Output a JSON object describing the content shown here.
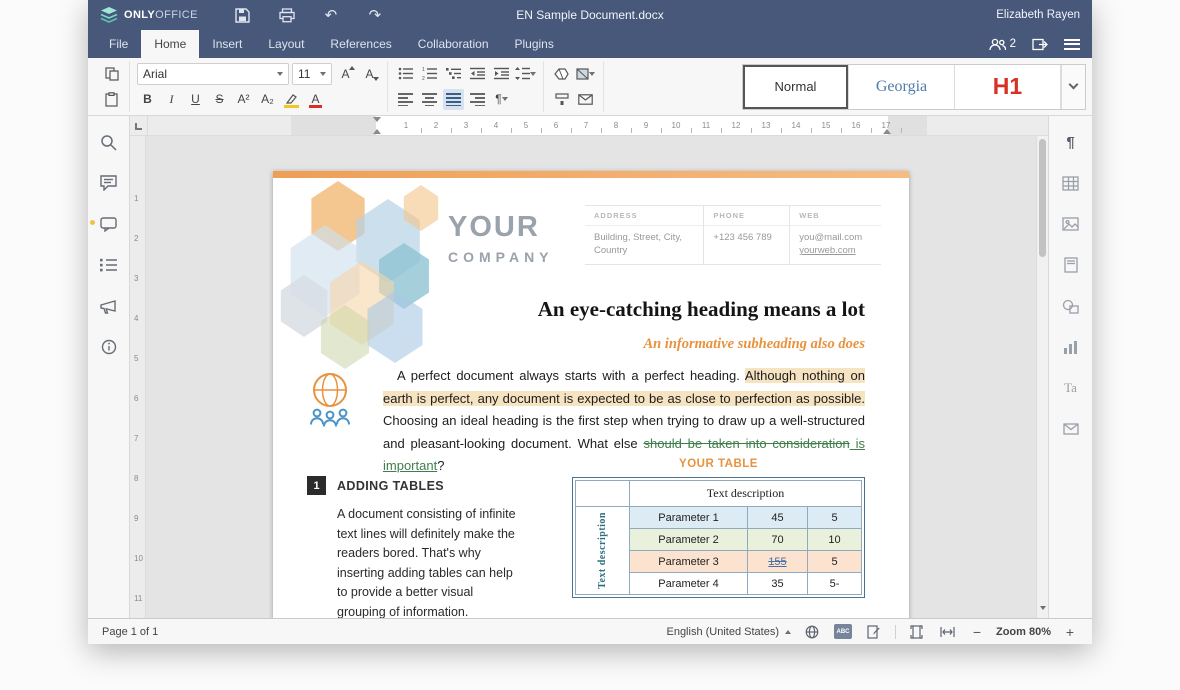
{
  "titlebar": {
    "brand_bold": "ONLY",
    "brand_light": "OFFICE",
    "document_title": "EN Sample Document.docx",
    "user_name": "Elizabeth Rayen"
  },
  "tabs": {
    "file": "File",
    "home": "Home",
    "insert": "Insert",
    "layout": "Layout",
    "references": "References",
    "collaboration": "Collaboration",
    "plugins": "Plugins",
    "users_count": "2"
  },
  "toolbar": {
    "font_name": "Arial",
    "font_size": "11",
    "letter_a": "A",
    "bold": "B",
    "italic": "I",
    "underline": "U",
    "strike": "S",
    "superscript": "A²",
    "subscript": "A₂",
    "para_mark": "¶",
    "styles": {
      "normal": "Normal",
      "georgia": "Georgia",
      "h1": "H1"
    }
  },
  "icons": {
    "undo": "↶",
    "redo": "↷",
    "text_art": "Ta"
  },
  "ruler": {
    "h": [
      "1",
      "2",
      "3",
      "4",
      "5",
      "6",
      "7",
      "8",
      "9",
      "10",
      "11",
      "12",
      "13",
      "14",
      "15",
      "16",
      "17"
    ],
    "v": [
      "1",
      "2",
      "3",
      "4",
      "5",
      "6",
      "7",
      "8",
      "9",
      "10",
      "11"
    ]
  },
  "doc": {
    "company_line1": "YOUR",
    "company_line2": "COMPANY",
    "contact": {
      "address_label": "ADDRESS",
      "phone_label": "PHONE",
      "web_label": "WEB",
      "address_1": "Building, Street, City,",
      "address_2": "Country",
      "phone": "+123 456 789",
      "web_1": "you@mail.com",
      "web_2": "yourweb.com"
    },
    "heading": "An eye-catching heading means a lot",
    "subheading": "An informative subheading also does",
    "paragraph": {
      "seg1": "A perfect document always starts with a perfect heading. ",
      "seg2_highlighted": "Although nothing on earth is perfect, any document is expected to be as close to perfection as possible.",
      "seg3": " Choosing an ideal heading is the first step when trying to draw up a well-structured and pleasant-looking document. What else ",
      "seg4_deleted": "should be taken into consideration",
      "seg5_inserted": " is important",
      "seg6": "?"
    },
    "section1": {
      "number": "1",
      "title": "ADDING TABLES",
      "body": "A document consisting of infinite text lines will definitely make the readers bored. That's why inserting adding tables can help to provide a better visual grouping of information."
    },
    "table": {
      "caption": "YOUR TABLE",
      "side_label": "Text description",
      "header": "Text description",
      "rows": [
        {
          "name": "Parameter 1",
          "v1": "45",
          "v2": "5",
          "bg": "#dcebf4"
        },
        {
          "name": "Parameter 2",
          "v1": "70",
          "v2": "10",
          "bg": "#e9f1dd"
        },
        {
          "name": "Parameter 3",
          "v1": "155",
          "v2": "5",
          "bg": "#fbe3d0",
          "v1_struck": true
        },
        {
          "name": "Parameter 4",
          "v1": "35",
          "v2": "5-",
          "bg": "#ffffff"
        }
      ]
    }
  },
  "statusbar": {
    "page_info": "Page 1 of 1",
    "language": "English (United States)",
    "spell_label": "ABC",
    "zoom_out": "−",
    "zoom_label": "Zoom 80%",
    "zoom_in": "+"
  },
  "colors": {
    "header_blue": "#47587a",
    "accent_orange": "#e8923d",
    "highlight": "#f6e3c1",
    "track_change_green": "#3f7d4b",
    "h1_red": "#d93025"
  }
}
